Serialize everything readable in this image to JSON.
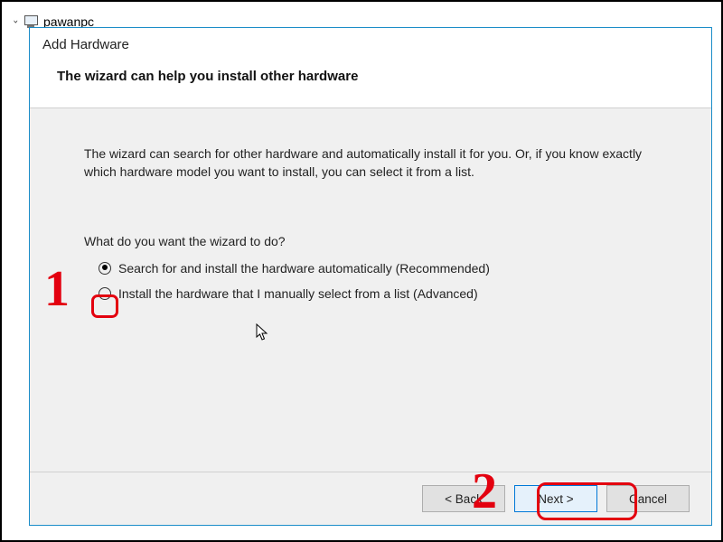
{
  "tree": {
    "root_label": "pawanpc"
  },
  "dialog": {
    "title": "Add Hardware",
    "subtitle": "The wizard can help you install other hardware",
    "intro": "The wizard can search for other hardware and automatically install it for you. Or, if you know exactly which hardware model you want to install, you can select it from a list.",
    "question": "What do you want the wizard to do?",
    "options": {
      "auto": "Search for and install the hardware automatically (Recommended)",
      "manual": "Install the hardware that I manually select from a list (Advanced)"
    },
    "buttons": {
      "back": "< Back",
      "next": "Next >",
      "cancel": "Cancel"
    }
  },
  "annotations": {
    "num1": "1",
    "num2": "2"
  }
}
